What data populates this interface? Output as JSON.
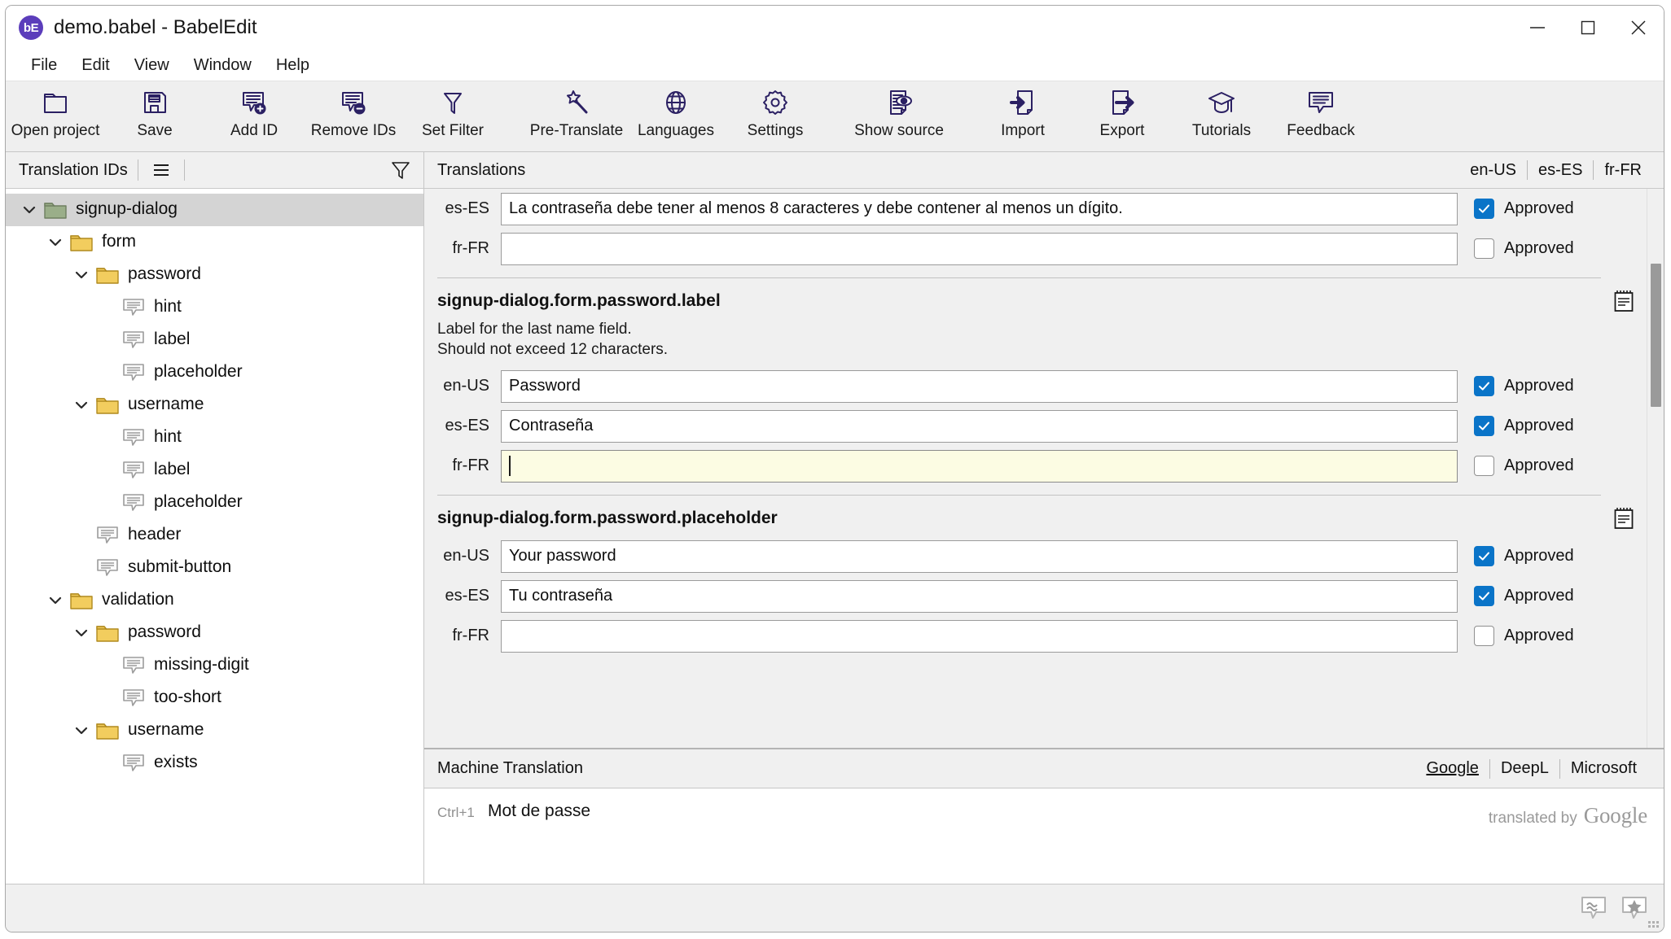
{
  "window": {
    "title": "demo.babel - BabelEdit",
    "logo_text": "bE",
    "controls": [
      {
        "name": "minimize",
        "icon": "minimize-icon"
      },
      {
        "name": "maximize",
        "icon": "maximize-icon"
      },
      {
        "name": "close",
        "icon": "close-icon"
      }
    ]
  },
  "menubar": {
    "items": [
      {
        "label": "File"
      },
      {
        "label": "Edit"
      },
      {
        "label": "View"
      },
      {
        "label": "Window"
      },
      {
        "label": "Help"
      }
    ]
  },
  "toolbar": {
    "items": [
      {
        "label": "Open project",
        "icon": "folder-open-icon"
      },
      {
        "label": "Save",
        "icon": "floppy-disk-icon"
      },
      {
        "label": "Add ID",
        "icon": "speech-bubble-plus-icon"
      },
      {
        "label": "Remove IDs",
        "icon": "speech-bubble-minus-icon"
      },
      {
        "label": "Set Filter",
        "icon": "funnel-icon"
      },
      {
        "label": "Pre-Translate",
        "icon": "magic-wand-icon"
      },
      {
        "label": "Languages",
        "icon": "globe-icon"
      },
      {
        "label": "Settings",
        "icon": "gear-icon"
      },
      {
        "label": "Show source",
        "icon": "document-eye-icon"
      },
      {
        "label": "Import",
        "icon": "import-document-icon"
      },
      {
        "label": "Export",
        "icon": "export-document-icon"
      },
      {
        "label": "Tutorials",
        "icon": "graduation-cap-icon"
      },
      {
        "label": "Feedback",
        "icon": "speech-bubble-icon"
      }
    ]
  },
  "left_panel": {
    "title": "Translation IDs",
    "list_view_icon": "list-view-icon",
    "filter_icon": "funnel-icon",
    "tree": [
      {
        "label": "signup-dialog",
        "depth": 0,
        "type": "folder",
        "expanded": true,
        "selected": true,
        "folder_color": "green"
      },
      {
        "label": "form",
        "depth": 1,
        "type": "folder",
        "expanded": true,
        "selected": false,
        "folder_color": "yellow"
      },
      {
        "label": "password",
        "depth": 2,
        "type": "folder",
        "expanded": true,
        "selected": false,
        "folder_color": "yellow"
      },
      {
        "label": "hint",
        "depth": 3,
        "type": "leaf",
        "expanded": false,
        "selected": false,
        "folder_color": ""
      },
      {
        "label": "label",
        "depth": 3,
        "type": "leaf",
        "expanded": false,
        "selected": false,
        "folder_color": ""
      },
      {
        "label": "placeholder",
        "depth": 3,
        "type": "leaf",
        "expanded": false,
        "selected": false,
        "folder_color": ""
      },
      {
        "label": "username",
        "depth": 2,
        "type": "folder",
        "expanded": true,
        "selected": false,
        "folder_color": "yellow"
      },
      {
        "label": "hint",
        "depth": 3,
        "type": "leaf",
        "expanded": false,
        "selected": false,
        "folder_color": ""
      },
      {
        "label": "label",
        "depth": 3,
        "type": "leaf",
        "expanded": false,
        "selected": false,
        "folder_color": ""
      },
      {
        "label": "placeholder",
        "depth": 3,
        "type": "leaf",
        "expanded": false,
        "selected": false,
        "folder_color": ""
      },
      {
        "label": "header",
        "depth": 2,
        "type": "leaf",
        "expanded": false,
        "selected": false,
        "folder_color": ""
      },
      {
        "label": "submit-button",
        "depth": 2,
        "type": "leaf",
        "expanded": false,
        "selected": false,
        "folder_color": ""
      },
      {
        "label": "validation",
        "depth": 1,
        "type": "folder",
        "expanded": true,
        "selected": false,
        "folder_color": "yellow"
      },
      {
        "label": "password",
        "depth": 2,
        "type": "folder",
        "expanded": true,
        "selected": false,
        "folder_color": "yellow"
      },
      {
        "label": "missing-digit",
        "depth": 3,
        "type": "leaf",
        "expanded": false,
        "selected": false,
        "folder_color": ""
      },
      {
        "label": "too-short",
        "depth": 3,
        "type": "leaf",
        "expanded": false,
        "selected": false,
        "folder_color": ""
      },
      {
        "label": "username",
        "depth": 2,
        "type": "folder",
        "expanded": true,
        "selected": false,
        "folder_color": "yellow"
      },
      {
        "label": "exists",
        "depth": 3,
        "type": "leaf",
        "expanded": false,
        "selected": false,
        "folder_color": ""
      }
    ]
  },
  "translations_panel": {
    "title": "Translations",
    "language_tabs": [
      "en-US",
      "es-ES",
      "fr-FR"
    ],
    "approved_label": "Approved",
    "note_icon": "notepad-icon",
    "entries": [
      {
        "id": "",
        "description": "",
        "partial_top": true,
        "show_note": false,
        "rows": [
          {
            "lang": "es-ES",
            "value": "La contraseña debe tener al menos 8 caracteres y debe contener al menos un dígito.",
            "approved": true,
            "focused": false
          },
          {
            "lang": "fr-FR",
            "value": "",
            "approved": false,
            "focused": false
          }
        ]
      },
      {
        "id": "signup-dialog.form.password.label",
        "description": "Label for the last name field.\nShould not exceed 12 characters.",
        "partial_top": false,
        "show_note": true,
        "rows": [
          {
            "lang": "en-US",
            "value": "Password",
            "approved": true,
            "focused": false
          },
          {
            "lang": "es-ES",
            "value": "Contraseña",
            "approved": true,
            "focused": false
          },
          {
            "lang": "fr-FR",
            "value": "",
            "approved": false,
            "focused": true
          }
        ]
      },
      {
        "id": "signup-dialog.form.password.placeholder",
        "description": "",
        "partial_top": false,
        "show_note": true,
        "rows": [
          {
            "lang": "en-US",
            "value": "Your password",
            "approved": true,
            "focused": false
          },
          {
            "lang": "es-ES",
            "value": "Tu contraseña",
            "approved": true,
            "focused": false
          },
          {
            "lang": "fr-FR",
            "value": "",
            "approved": false,
            "focused": false
          }
        ]
      }
    ]
  },
  "machine_translation": {
    "title": "Machine Translation",
    "providers": [
      {
        "label": "Google",
        "active": true
      },
      {
        "label": "DeepL",
        "active": false
      },
      {
        "label": "Microsoft",
        "active": false
      }
    ],
    "shortcut": "Ctrl+1",
    "suggestion": "Mot de passe",
    "credit_text": "translated by",
    "credit_brand": "Google"
  },
  "statusbar": {
    "icons": [
      {
        "name": "fuzzy-match-icon",
        "glyph": "≈"
      },
      {
        "name": "favorite-icon",
        "glyph": "★"
      }
    ]
  },
  "colors": {
    "accent": "#2b2063",
    "checkbox_checked": "#0a74c8",
    "focused_field": "#fcfce3",
    "selection": "#d4d4d4",
    "folder_yellow": "#f2cd5e",
    "folder_green": "#9aae89"
  }
}
